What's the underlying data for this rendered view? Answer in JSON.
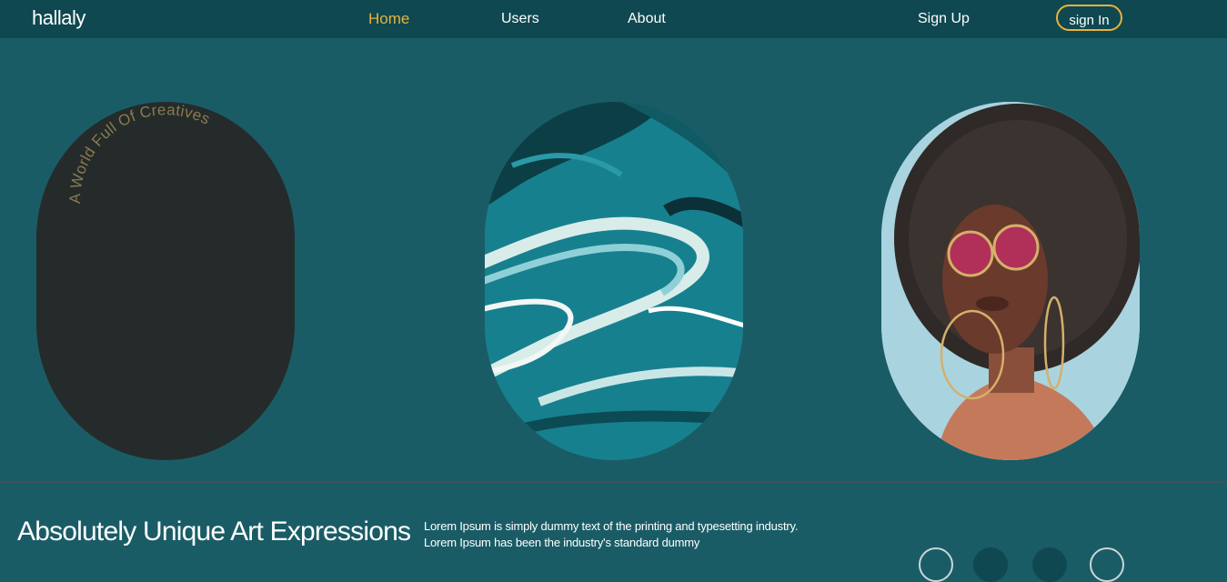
{
  "navbar": {
    "brand": "hallaly",
    "links": [
      {
        "label": "Home",
        "active": true
      },
      {
        "label": "Users",
        "active": false
      },
      {
        "label": "About",
        "active": false
      }
    ],
    "sign_up_label": "Sign Up",
    "sign_in_label": "sign In"
  },
  "hero": {
    "arc_text": "A World Full Of Creatives",
    "images": [
      {
        "name": "dark-oval-panel",
        "color": "#252b2b"
      },
      {
        "name": "teal-marble-swirl-image",
        "color": "#1e7e8c"
      },
      {
        "name": "portrait-afro-sunglasses-image",
        "color": "#a9d4df"
      }
    ]
  },
  "feature": {
    "title": "Absolutely Unique Art Expressions",
    "description": "Lorem Ipsum is simply dummy text of the printing and typesetting industry. Lorem Ipsum has been the industry's standard dummy"
  },
  "colors": {
    "background": "#1a5c66",
    "navbar": "#0f4850",
    "accent": "#e8b23c",
    "text": "#ffffff"
  }
}
